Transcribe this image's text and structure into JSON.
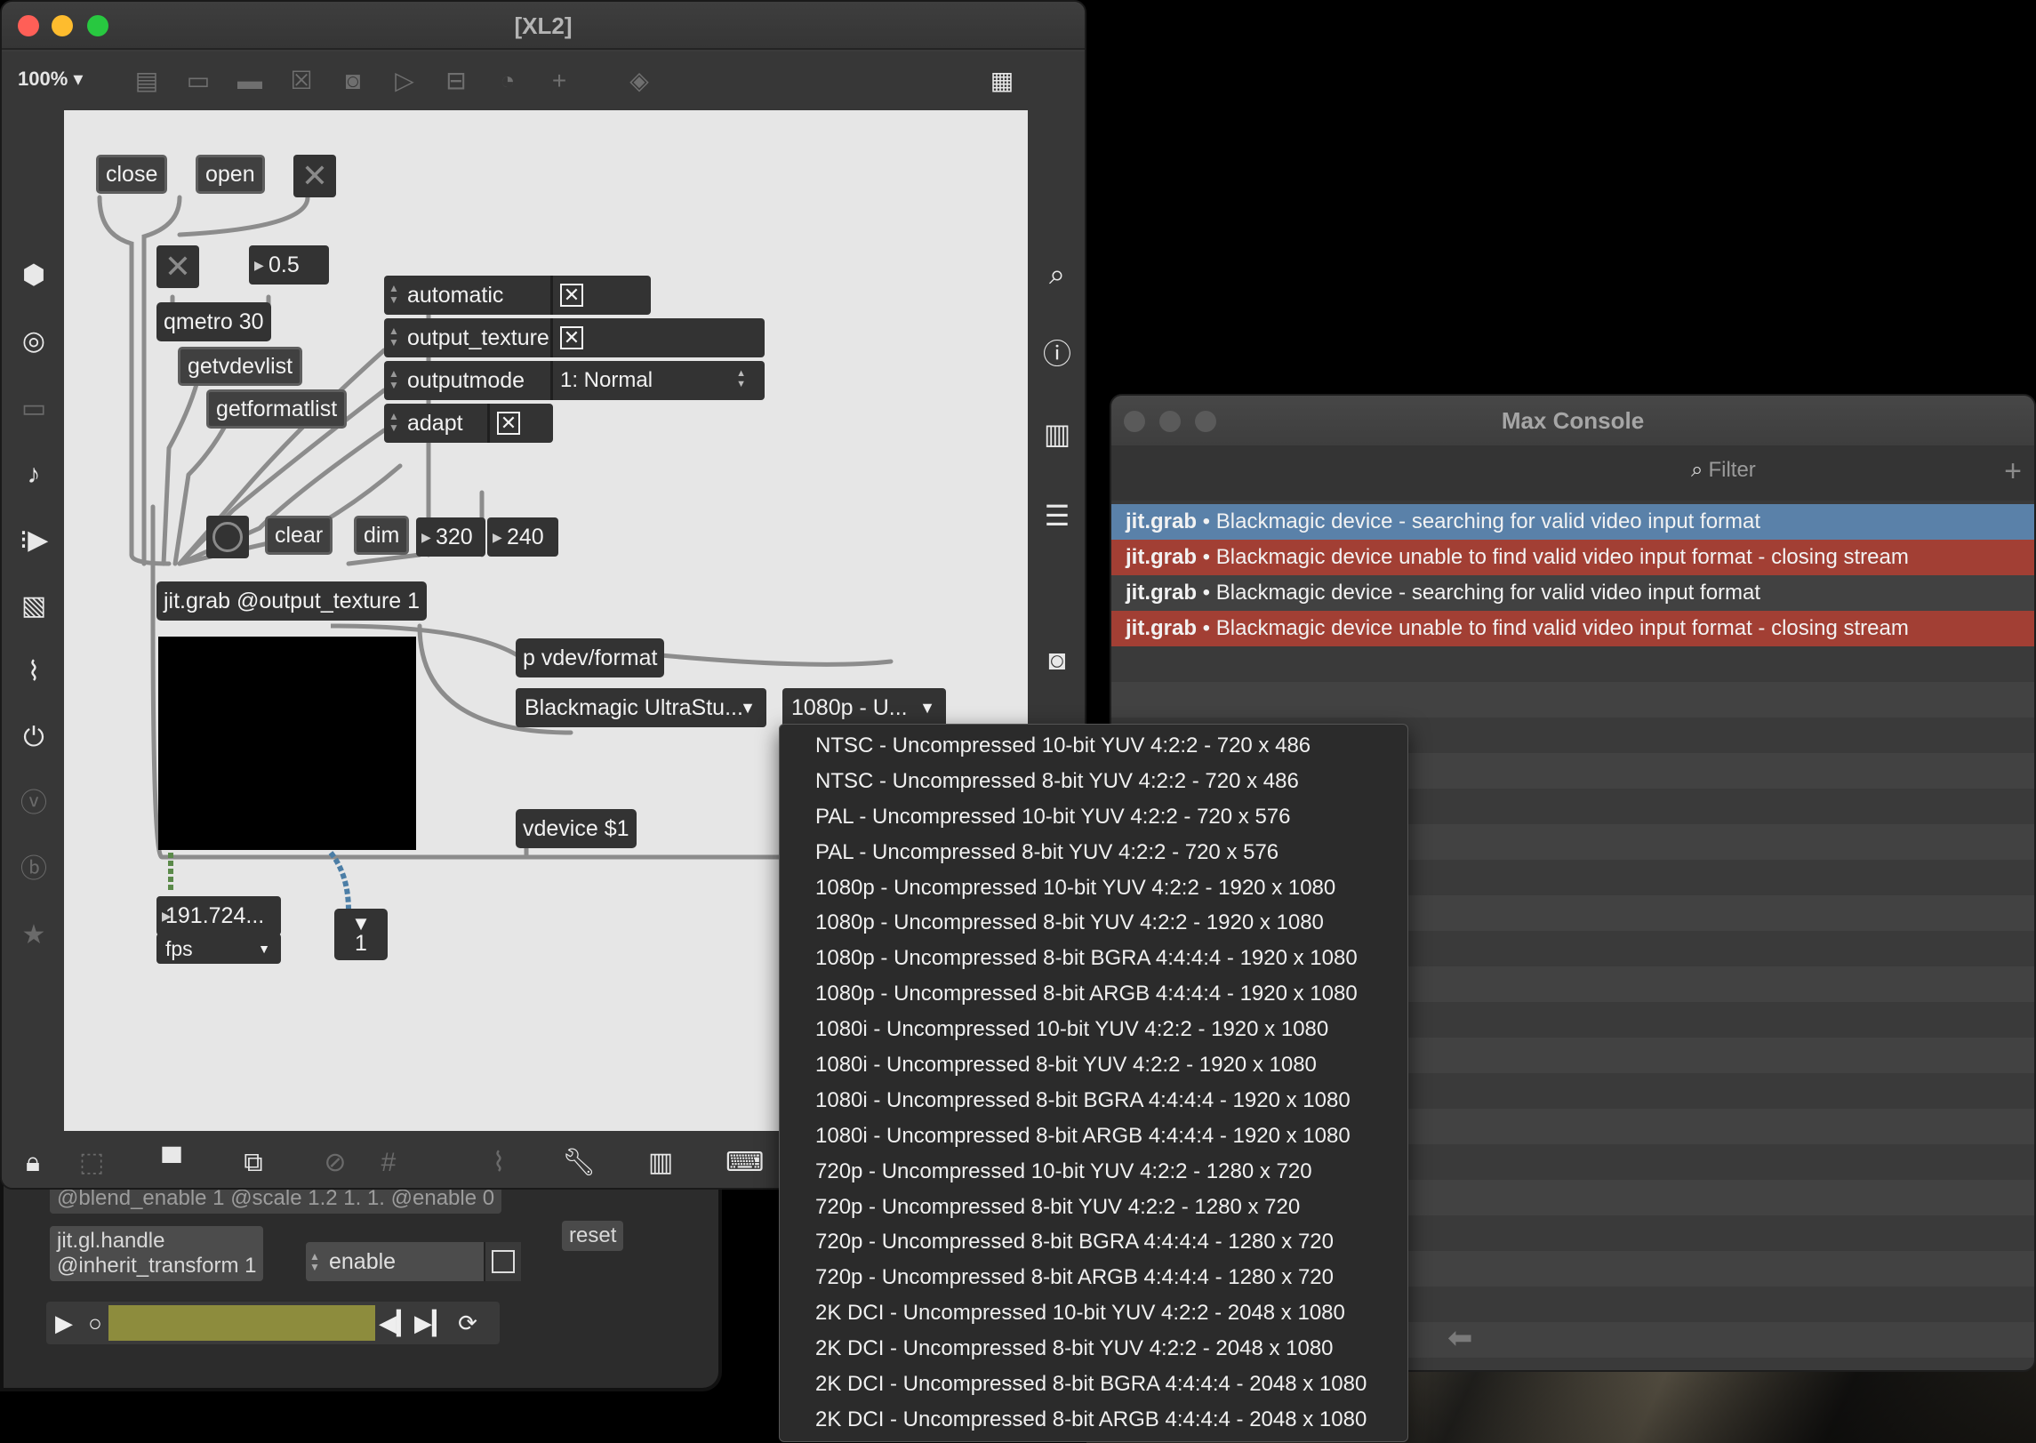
{
  "patcher": {
    "title": "[XL2]",
    "zoom": "100%",
    "objects": {
      "close": "close",
      "open": "open",
      "number_half": "0.5",
      "qmetro": "qmetro 30",
      "getvdevlist": "getvdevlist",
      "getformatlist": "getformatlist",
      "automatic": "automatic",
      "output_texture": "output_texture",
      "outputmode": "outputmode",
      "outputmode_value": "1: Normal",
      "adapt": "adapt",
      "clear": "clear",
      "dim": "dim",
      "dim_w": "320",
      "dim_h": "240",
      "jitgrab": "jit.grab @output_texture 1",
      "pvdev": "p vdev/format",
      "device_menu": "Blackmagic UltraStu...",
      "format_menu": "1080p - U...",
      "vdevice": "vdevice $1",
      "fps_value": "191.724...",
      "fps_menu": "fps",
      "gate_value": "1"
    }
  },
  "back_patcher": {
    "blend_text": "@blend_enable 1 @scale 1.2 1. 1. @enable 0",
    "handle_text": "jit.gl.handle\n@inherit_transform 1",
    "enable_label": "enable",
    "reset_label": "reset"
  },
  "console": {
    "title": "Max Console",
    "filter_placeholder": "Filter",
    "rows": [
      {
        "source": "jit.grab",
        "message": " • Blackmagic device - searching for valid video input format",
        "kind": "info"
      },
      {
        "source": "jit.grab",
        "message": " • Blackmagic device unable to find valid video input format - closing stream",
        "kind": "error"
      },
      {
        "source": "jit.grab",
        "message": " • Blackmagic device - searching for valid video input format",
        "kind": "plain"
      },
      {
        "source": "jit.grab",
        "message": " • Blackmagic device unable to find valid video input format - closing stream",
        "kind": "error"
      }
    ]
  },
  "format_menu_items": [
    "NTSC - Uncompressed 10-bit YUV 4:2:2 - 720 x 486",
    "NTSC - Uncompressed 8-bit YUV 4:2:2 - 720 x 486",
    "PAL - Uncompressed 10-bit YUV 4:2:2 - 720 x 576",
    "PAL - Uncompressed 8-bit YUV 4:2:2 - 720 x 576",
    "1080p - Uncompressed 10-bit YUV 4:2:2 - 1920 x 1080",
    "1080p - Uncompressed 8-bit YUV 4:2:2 - 1920 x 1080",
    "1080p - Uncompressed 8-bit BGRA 4:4:4:4 - 1920 x 1080",
    "1080p - Uncompressed 8-bit ARGB 4:4:4:4 - 1920 x 1080",
    "1080i - Uncompressed 10-bit YUV 4:2:2 - 1920 x 1080",
    "1080i - Uncompressed 8-bit YUV 4:2:2 - 1920 x 1080",
    "1080i - Uncompressed 8-bit BGRA 4:4:4:4 - 1920 x 1080",
    "1080i - Uncompressed 8-bit ARGB 4:4:4:4 - 1920 x 1080",
    "720p - Uncompressed 10-bit YUV 4:2:2 - 1280 x 720",
    "720p - Uncompressed 8-bit YUV 4:2:2 - 1280 x 720",
    "720p - Uncompressed 8-bit BGRA 4:4:4:4 - 1280 x 720",
    "720p - Uncompressed 8-bit ARGB 4:4:4:4 - 1280 x 720",
    "2K DCI - Uncompressed 10-bit YUV 4:2:2 - 2048 x 1080",
    "2K DCI - Uncompressed 8-bit YUV 4:2:2 - 2048 x 1080",
    "2K DCI - Uncompressed 8-bit BGRA 4:4:4:4 - 2048 x 1080",
    "2K DCI - Uncompressed 8-bit ARGB 4:4:4:4 - 2048 x 1080"
  ],
  "colors": {
    "traffic_red": "#ff5f57",
    "traffic_yellow": "#febc2e",
    "traffic_green": "#28c840",
    "console_info": "#5a81a9",
    "console_error": "#a23f34"
  }
}
